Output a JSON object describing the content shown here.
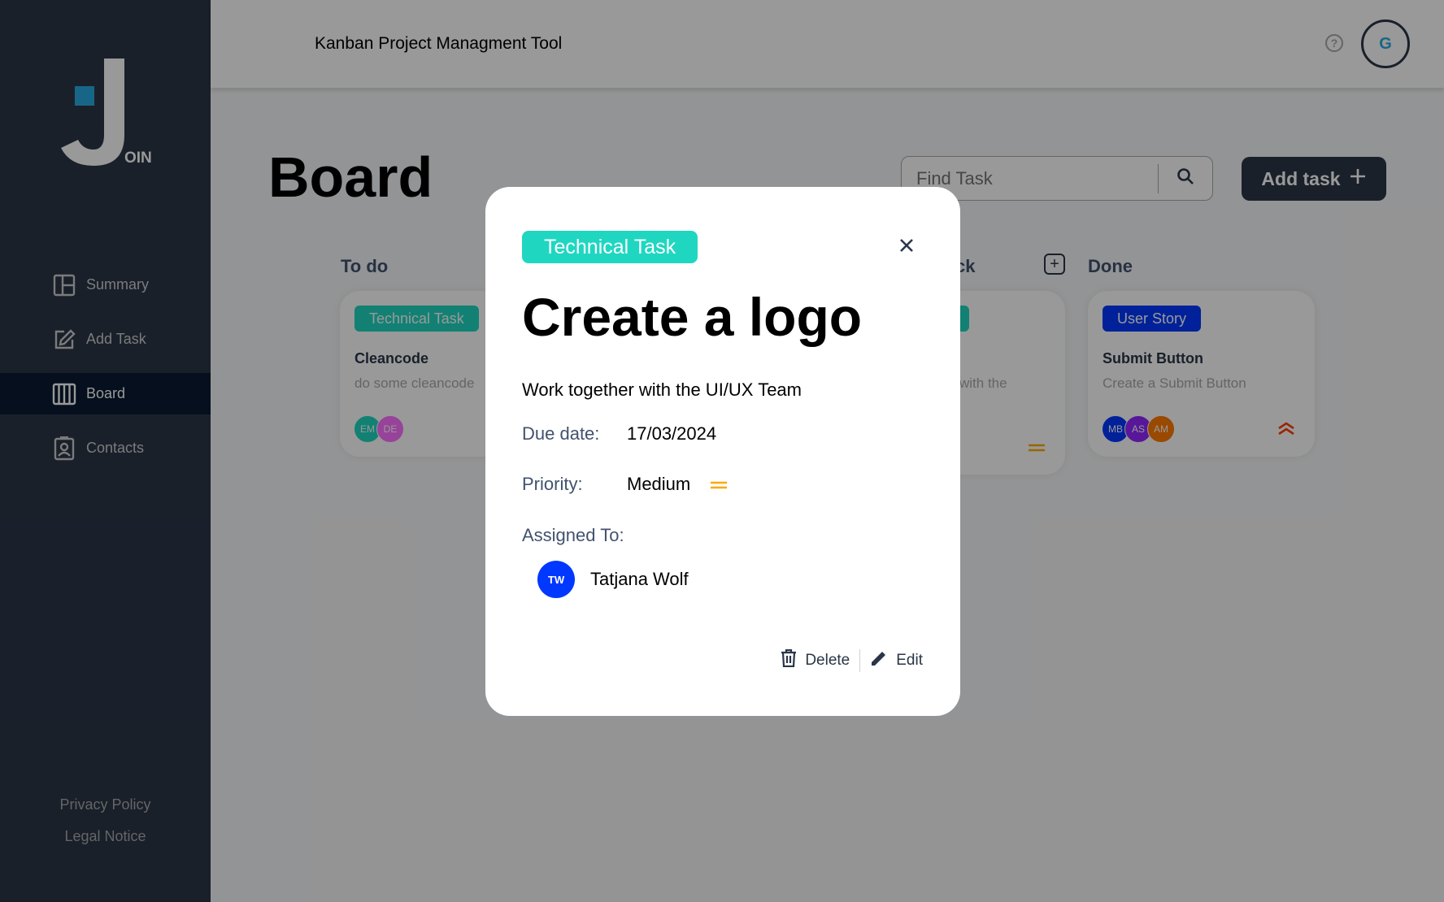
{
  "app": {
    "logo_suffix": "OIN",
    "header_title": "Kanban Project Managment Tool",
    "help_label": "?",
    "user_initial": "G"
  },
  "sidebar": {
    "items": [
      {
        "label": "Summary",
        "icon": "summary-icon"
      },
      {
        "label": "Add Task",
        "icon": "edit-icon"
      },
      {
        "label": "Board",
        "icon": "board-icon"
      },
      {
        "label": "Contacts",
        "icon": "contacts-icon"
      }
    ],
    "footer": {
      "privacy": "Privacy Policy",
      "legal": "Legal Notice"
    }
  },
  "board": {
    "title": "Board",
    "search_placeholder": "Find Task",
    "add_task_label": "Add task",
    "columns": {
      "todo": "To do",
      "feedback_partial": "ck",
      "done": "Done"
    }
  },
  "cards": {
    "todo": {
      "tag": "Technical Task",
      "title": "Cleancode",
      "desc": "do some cleancode",
      "avatars": [
        {
          "initials": "EM",
          "color": "#1fd7c1"
        },
        {
          "initials": "DE",
          "color": "#fc71ff"
        }
      ]
    },
    "feedback": {
      "tag_partial": "sk",
      "desc_partial": "with the"
    },
    "done": {
      "tag": "User Story",
      "title": "Submit Button",
      "desc": "Create a Submit Button",
      "avatars": [
        {
          "initials": "MB",
          "color": "#0038ff"
        },
        {
          "initials": "AS",
          "color": "#9327ff"
        },
        {
          "initials": "AM",
          "color": "#ff7a00"
        }
      ]
    }
  },
  "modal": {
    "tag": "Technical Task",
    "title": "Create a logo",
    "description": "Work together with the UI/UX Team",
    "due_label": "Due date:",
    "due_value": "17/03/2024",
    "priority_label": "Priority:",
    "priority_value": "Medium",
    "assigned_label": "Assigned To:",
    "assignee_initials": "TW",
    "assignee_name": "Tatjana Wolf",
    "delete_label": "Delete",
    "edit_label": "Edit"
  },
  "colors": {
    "sidebar": "#2a3647",
    "technical_task": "#1fd7c1",
    "user_story": "#0038ff",
    "priority_medium": "#ffa800",
    "priority_urgent": "#ff3d00"
  }
}
